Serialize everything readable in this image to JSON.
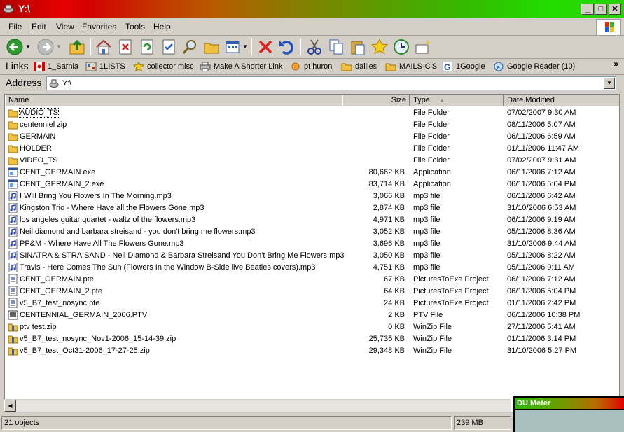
{
  "window": {
    "title": "Y:\\"
  },
  "menu": [
    "File",
    "Edit",
    "View",
    "Favorites",
    "Tools",
    "Help"
  ],
  "links": {
    "label": "Links",
    "items": [
      "1_Sarnia",
      "1LISTS",
      "collector misc",
      "Make A Shorter Link",
      "pt huron",
      "dailies",
      "MAILS-C'S",
      "1Google",
      "Google Reader (10)"
    ]
  },
  "address": {
    "label": "Address",
    "value": "Y:\\"
  },
  "columns": {
    "name": "Name",
    "size": "Size",
    "type": "Type",
    "date": "Date Modified"
  },
  "files": [
    {
      "name": "AUDIO_TS",
      "size": "",
      "type": "File Folder",
      "date": "07/02/2007 9:30 AM",
      "icon": "folder-icon"
    },
    {
      "name": "centenniel zip",
      "size": "",
      "type": "File Folder",
      "date": "08/11/2006 5:07 AM",
      "icon": "folder-icon"
    },
    {
      "name": "GERMAIN",
      "size": "",
      "type": "File Folder",
      "date": "06/11/2006 6:59 AM",
      "icon": "folder-icon"
    },
    {
      "name": "HOLDER",
      "size": "",
      "type": "File Folder",
      "date": "01/11/2006 11:47 AM",
      "icon": "folder-icon"
    },
    {
      "name": "VIDEO_TS",
      "size": "",
      "type": "File Folder",
      "date": "07/02/2007 9:31 AM",
      "icon": "folder-icon"
    },
    {
      "name": "CENT_GERMAIN.exe",
      "size": "80,662 KB",
      "type": "Application",
      "date": "06/11/2006 7:12 AM",
      "icon": "exe-icon"
    },
    {
      "name": "CENT_GERMAIN_2.exe",
      "size": "83,714 KB",
      "type": "Application",
      "date": "06/11/2006 5:04 PM",
      "icon": "exe-icon"
    },
    {
      "name": "I Will Bring You Flowers In The Morning.mp3",
      "size": "3,066 KB",
      "type": "mp3 file",
      "date": "06/11/2006 6:42 AM",
      "icon": "mp3-icon"
    },
    {
      "name": "Kingston Trio - Where Have all the Flowers Gone.mp3",
      "size": "2,874 KB",
      "type": "mp3 file",
      "date": "31/10/2006 6:53 AM",
      "icon": "mp3-icon"
    },
    {
      "name": "los angeles guitar quartet - waltz of the flowers.mp3",
      "size": "4,971 KB",
      "type": "mp3 file",
      "date": "06/11/2006 9:19 AM",
      "icon": "mp3-icon"
    },
    {
      "name": "Neil diamond and barbara streisand - you don't bring me flowers.mp3",
      "size": "3,052 KB",
      "type": "mp3 file",
      "date": "05/11/2006 8:36 AM",
      "icon": "mp3-icon"
    },
    {
      "name": "PP&M - Where Have All The Flowers Gone.mp3",
      "size": "3,696 KB",
      "type": "mp3 file",
      "date": "31/10/2006 9:44 AM",
      "icon": "mp3-icon"
    },
    {
      "name": "SINATRA & STRAISAND - Neil Diamond & Barbara Streisand You Don't Bring Me Flowers.mp3",
      "size": "3,050 KB",
      "type": "mp3 file",
      "date": "05/11/2006 8:22 AM",
      "icon": "mp3-icon"
    },
    {
      "name": "Travis - Here Comes The Sun (Flowers In the Window B-Side live Beatles covers).mp3",
      "size": "4,751 KB",
      "type": "mp3 file",
      "date": "05/11/2006 9:11 AM",
      "icon": "mp3-icon"
    },
    {
      "name": "CENT_GERMAIN.pte",
      "size": "67 KB",
      "type": "PicturesToExe Project",
      "date": "06/11/2006 7:12 AM",
      "icon": "pte-icon"
    },
    {
      "name": "CENT_GERMAIN_2.pte",
      "size": "64 KB",
      "type": "PicturesToExe Project",
      "date": "06/11/2006 5:04 PM",
      "icon": "pte-icon"
    },
    {
      "name": "v5_B7_test_nosync.pte",
      "size": "24 KB",
      "type": "PicturesToExe Project",
      "date": "01/11/2006 2:42 PM",
      "icon": "pte-icon"
    },
    {
      "name": "CENTENNIAL_GERMAIN_2006.PTV",
      "size": "2 KB",
      "type": "PTV File",
      "date": "06/11/2006 10:38 PM",
      "icon": "ptv-icon"
    },
    {
      "name": "ptv test.zip",
      "size": "0 KB",
      "type": "WinZip File",
      "date": "27/11/2006 5:41 AM",
      "icon": "zip-icon"
    },
    {
      "name": "v5_B7_test_nosync_Nov1-2006_15-14-39.zip",
      "size": "25,735 KB",
      "type": "WinZip File",
      "date": "01/11/2006 3:14 PM",
      "icon": "zip-icon"
    },
    {
      "name": "v5_B7_test_Oct31-2006_17-27-25.zip",
      "size": "29,348 KB",
      "type": "WinZip File",
      "date": "31/10/2006 5:27 PM",
      "icon": "zip-icon"
    }
  ],
  "status": {
    "count": "21 objects",
    "size": "239 MB"
  },
  "dumeter": {
    "label": "DU Meter"
  }
}
